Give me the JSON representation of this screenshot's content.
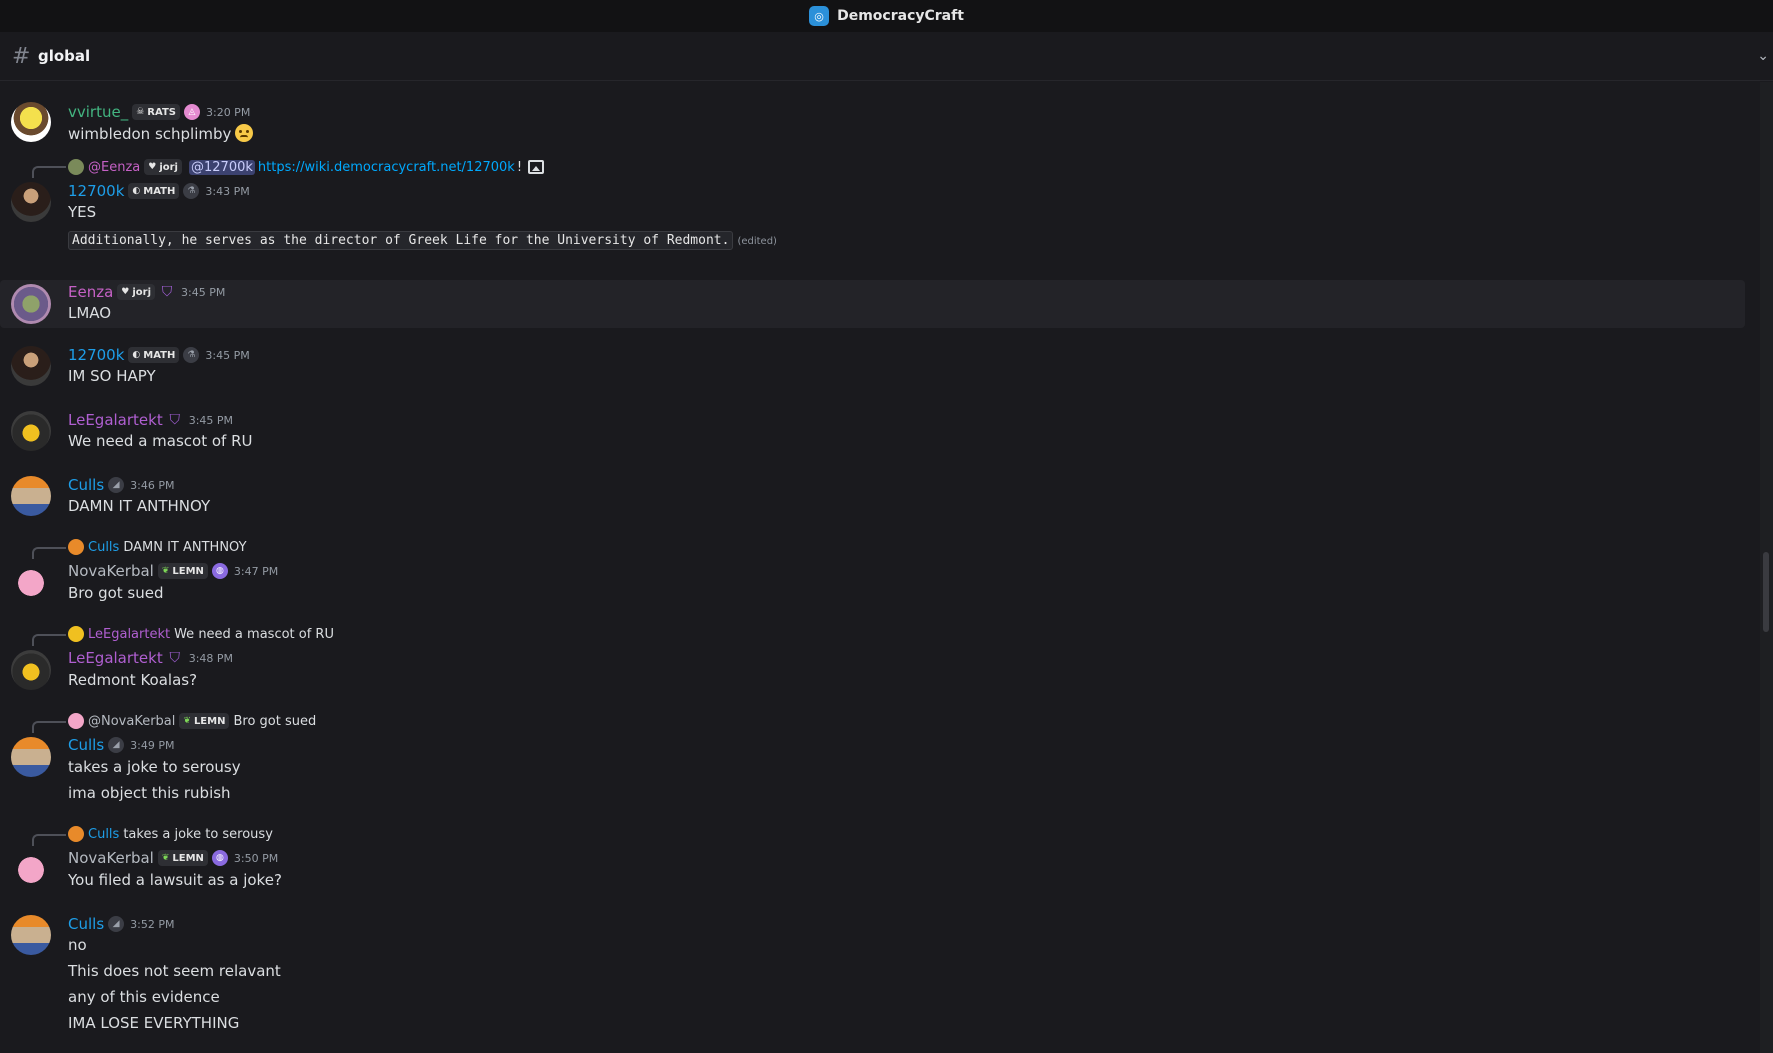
{
  "window": {
    "title": "DemocracyCraft"
  },
  "channel": {
    "name": "global"
  },
  "colors": {
    "name_green": "#43b581",
    "name_blue": "#1e9ee8",
    "name_pink": "#c561c5",
    "name_purple": "#b05fd1",
    "name_gray": "#b5bac1",
    "link": "#00a8fc",
    "mention_bg": "#3c4270"
  },
  "messages": [
    {
      "author": "vvirtue_",
      "tag": "RATS",
      "time": "3:20 PM",
      "lines": [
        "wimbledon schplimby"
      ],
      "emoji": "grimace-emoji"
    },
    {
      "reply": {
        "author": "@Eenza",
        "tag": "jorj",
        "mention": "@12700k",
        "link": "https://wiki.democracycraft.net/12700k",
        "suffix": "!"
      },
      "author": "12700k",
      "tag": "MATH",
      "time": "3:43 PM",
      "lines": [
        "YES"
      ],
      "code": "Additionally, he serves as the director of Greek Life for the University of Redmont.",
      "edited": "(edited)"
    },
    {
      "author": "Eenza",
      "tag": "jorj",
      "time": "3:45 PM",
      "lines": [
        "LMAO"
      ]
    },
    {
      "author": "12700k",
      "tag": "MATH",
      "time": "3:45 PM",
      "lines": [
        "IM SO HAPY"
      ]
    },
    {
      "author": "LeEgalartekt",
      "time": "3:45 PM",
      "lines": [
        "We need a mascot of RU"
      ]
    },
    {
      "author": "Culls",
      "time": "3:46 PM",
      "lines": [
        "DAMN IT ANTHNOY"
      ]
    },
    {
      "reply": {
        "author": "Culls",
        "text": "DAMN IT ANTHNOY"
      },
      "author": "NovaKerbal",
      "tag": "LEMN",
      "time": "3:47 PM",
      "lines": [
        "Bro got sued"
      ]
    },
    {
      "reply": {
        "author": "LeEgalartekt",
        "text": "We need a mascot of RU"
      },
      "author": "LeEgalartekt",
      "time": "3:48 PM",
      "lines": [
        "Redmont Koalas?"
      ]
    },
    {
      "reply": {
        "author": "@NovaKerbal",
        "tag": "LEMN",
        "text": "Bro got sued"
      },
      "author": "Culls",
      "time": "3:49 PM",
      "lines": [
        "takes a joke to serousy",
        "ima object this rubish"
      ]
    },
    {
      "reply": {
        "author": "Culls",
        "text": "takes a joke to serousy"
      },
      "author": "NovaKerbal",
      "tag": "LEMN",
      "time": "3:50 PM",
      "lines": [
        "You filed a lawsuit as a joke?"
      ]
    },
    {
      "author": "Culls",
      "time": "3:52 PM",
      "lines": [
        "no",
        "This does not seem relavant",
        "any of this evidence",
        "IMA LOSE EVERYTHING"
      ]
    }
  ]
}
